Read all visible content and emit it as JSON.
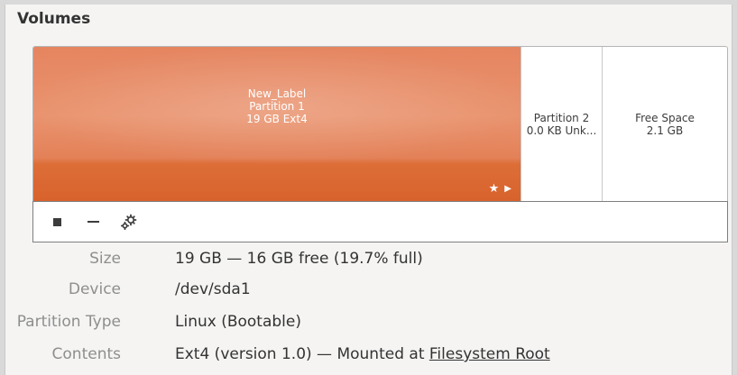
{
  "volumes": {
    "heading": "Volumes",
    "segments": [
      {
        "label": "New_Label",
        "name": "Partition 1",
        "detail": "19 GB Ext4",
        "color": "#e47a4e",
        "flags": [
          "star-icon",
          "play-icon"
        ]
      },
      {
        "name": "Partition 2",
        "detail": "0.0 KB Unk..."
      },
      {
        "name": "Free Space",
        "detail": "2.1 GB"
      }
    ],
    "toolbar": {
      "icons": [
        "stop-icon",
        "minus-icon",
        "gears-icon"
      ]
    }
  },
  "properties": {
    "size": {
      "label": "Size",
      "value": "19 GB — 16 GB free (19.7% full)"
    },
    "device": {
      "label": "Device",
      "value": "/dev/sda1"
    },
    "partition_type": {
      "label": "Partition Type",
      "value": "Linux (Bootable)"
    },
    "contents": {
      "label": "Contents",
      "value_prefix": "Ext4 (version 1.0) — Mounted at ",
      "link": "Filesystem Root"
    }
  }
}
